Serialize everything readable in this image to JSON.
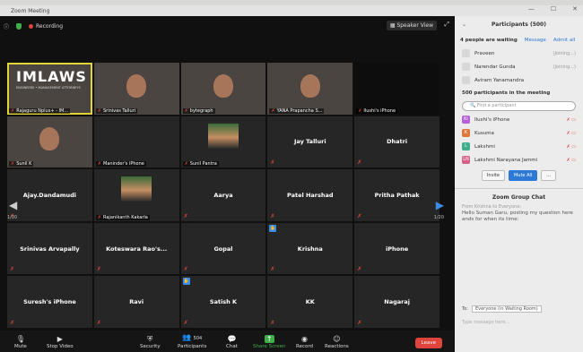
{
  "window": {
    "title": "Zoom Meeting"
  },
  "meeting": {
    "recording_label": "Recording",
    "speaker_view_label": "Speaker View",
    "page_left": "1/20",
    "page_right": "1/20"
  },
  "tiles": [
    {
      "label": "Rajaguru Nplus+ - IM...",
      "video": true,
      "speaking": true,
      "logo": "IMLAWS",
      "subtext": "ENGINEERS • MANAGEMENT ATTORNEYS"
    },
    {
      "label": "Srinivas Talluri",
      "video": true
    },
    {
      "label": "bytegraph",
      "video": true
    },
    {
      "label": "YANA Prapancha S...",
      "video": true
    },
    {
      "label": "Ilushi's iPhone",
      "video": false,
      "dark": true
    },
    {
      "label": "Sunil K",
      "video": true
    },
    {
      "label": "Maninder's iPhone",
      "video": false
    },
    {
      "label": "Sunil Pantra",
      "video": false,
      "photo": true
    },
    {
      "name": "Jay Talluri"
    },
    {
      "name": "Dhatri"
    },
    {
      "name": "Ajay.Dandamudi"
    },
    {
      "label": "Rajanikanth Kakarla",
      "photo": true
    },
    {
      "name": "Aarya"
    },
    {
      "name": "Patel Harshad"
    },
    {
      "name": "Pritha Pathak"
    },
    {
      "name": "Srinivas Arvapally"
    },
    {
      "name": "Koteswara Rao's..."
    },
    {
      "name": "Gopal"
    },
    {
      "name": "Krishna",
      "hand": true
    },
    {
      "name": "iPhone"
    },
    {
      "name": "Suresh's iPhone"
    },
    {
      "name": "Ravi"
    },
    {
      "name": "Satish K",
      "hand": true
    },
    {
      "name": "KK"
    },
    {
      "name": "Nagaraj"
    }
  ],
  "toolbar": {
    "mute": "Mute",
    "stop_video": "Stop Video",
    "security": "Security",
    "participants": "Participants",
    "participants_count": "504",
    "chat": "Chat",
    "share_screen": "Share Screen",
    "record": "Record",
    "reactions": "Reactions",
    "leave": "Leave"
  },
  "panel": {
    "title": "Participants (500)",
    "waiting_text": "4 people are waiting",
    "message_link": "Message",
    "admit_all_link": "Admit all",
    "waiting": [
      {
        "name": "Praveen",
        "status": "(Joining...)"
      },
      {
        "name": "Narendar Gunda",
        "status": "(Joining...)"
      },
      {
        "name": "Aviram Yanamandra",
        "status": ""
      }
    ],
    "in_meeting_title": "500 participants in the meeting",
    "find_placeholder": "Find a participant",
    "participants": [
      {
        "initial": "Ki",
        "name": "Ilushi's iPhone",
        "color": "#b45fd6"
      },
      {
        "initial": "K",
        "name": "Kusuma",
        "color": "#e0773d"
      },
      {
        "initial": "L",
        "name": "Lakshmi",
        "color": "#3fae8a"
      },
      {
        "initial": "LN",
        "name": "Lakshmi Narayana Jammi",
        "color": "#d65f8a"
      }
    ],
    "invite": "Invite",
    "mute_all": "Mute All",
    "more": "...",
    "chat_title": "Zoom Group Chat",
    "chat_from": "From Krishna to Everyone:",
    "chat_message": "Hello Suman Garu, posting my question here ands for when its time:",
    "to_label": "To:",
    "to_value": "Everyone (in Waiting Room)",
    "type_placeholder": "Type message here..."
  }
}
